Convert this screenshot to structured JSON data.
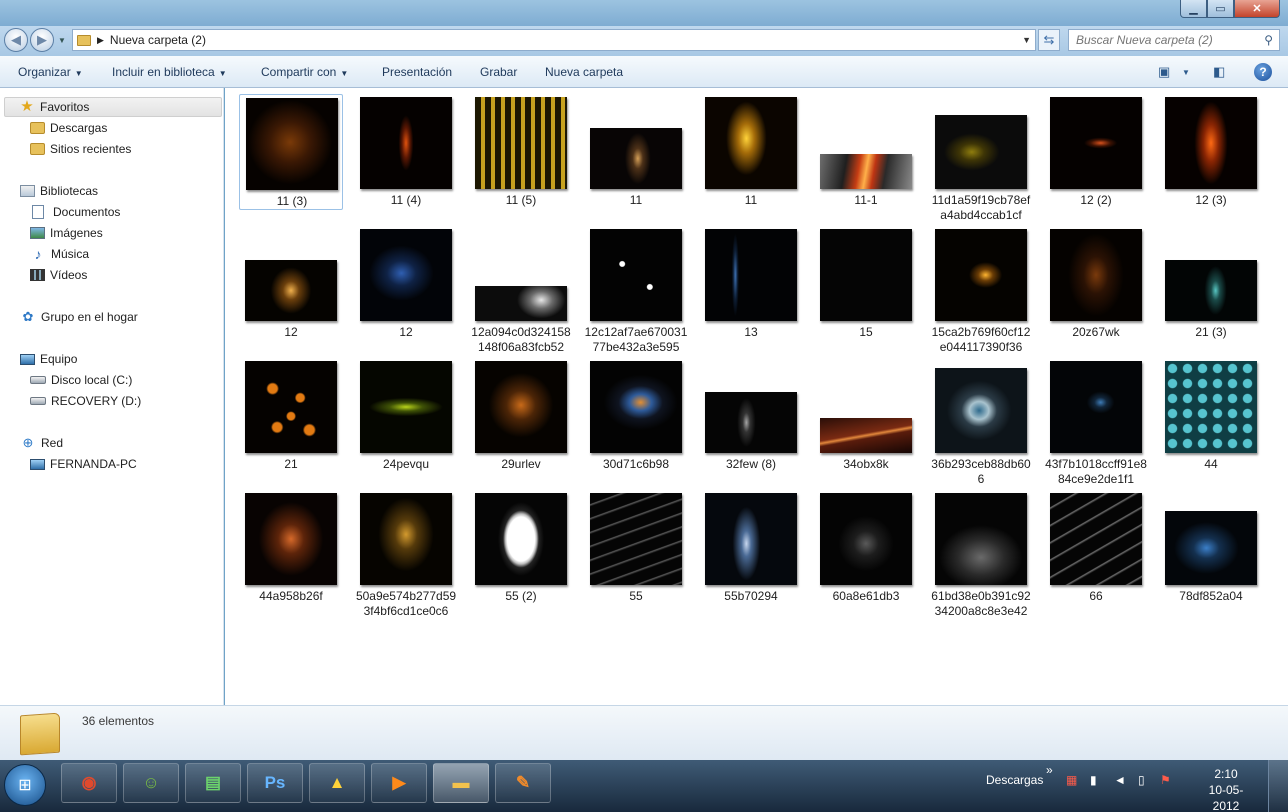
{
  "window": {
    "minimize": "▁",
    "maximize": "▭",
    "close": "✕"
  },
  "address": {
    "path": "Nueva carpeta (2)",
    "search_placeholder": "Buscar Nueva carpeta (2)"
  },
  "toolbar": {
    "organize": "Organizar",
    "include_library": "Incluir en biblioteca",
    "share": "Compartir con",
    "presentation": "Presentación",
    "burn": "Grabar",
    "new_folder": "Nueva carpeta",
    "help": "?"
  },
  "nav": {
    "favorites": "Favoritos",
    "downloads": "Descargas",
    "recent": "Sitios recientes",
    "libraries": "Bibliotecas",
    "documents": "Documentos",
    "images": "Imágenes",
    "music": "Música",
    "videos": "Vídeos",
    "homegroup": "Grupo en el hogar",
    "computer": "Equipo",
    "local_disk": "Disco local (C:)",
    "recovery": "RECOVERY (D:)",
    "network": "Red",
    "network_pc": "FERNANDA-PC"
  },
  "files": [
    {
      "name": "11 (3)",
      "bg": "radial-gradient(ellipse at 48% 48%, #7a3a08 0%, #3a1804 30%, #060200 62%)",
      "h": 1
    },
    {
      "name": "11 (4)",
      "bg": "radial-gradient(ellipse 8% 30% at 50% 50%, #e0520e 0%, #5a1703 55%, #050100 100%)",
      "h": 1
    },
    {
      "name": "11 (5)",
      "bg": "repeating-linear-gradient(90deg, #1d1802 0 6px, #c7a21f 6px 10px)",
      "h": 1
    },
    {
      "name": "11",
      "bg": "radial-gradient(ellipse 14% 42% at 52% 50%, #d49e56 0%, #4d3118 40%, #080505 100%)",
      "h": 0.66
    },
    {
      "name": "11",
      "bg": "radial-gradient(ellipse 22% 40% at 45% 45%, #ffd33a 0%, #a56c09 40%, #0b0500 100%)",
      "h": 1
    },
    {
      "name": "11-1",
      "bg": "linear-gradient(100deg, #6e6e6e 0%, #1f1f1f 28%, #c63d14 42%, #ffb04a 50%, #bf3513 58%, #2a2a2a 70%, #8a8a8a 100%)",
      "h": 0.38
    },
    {
      "name": "11d1a59f19cb78efa4abd4ccab1cf",
      "bg": "radial-gradient(ellipse 30% 25% at 40% 50%, #8f7d0e 0%, #3e3506 45%, #0b0b0b 100%)",
      "h": 0.8
    },
    {
      "name": "12 (2)",
      "bg": "radial-gradient(ellipse 18% 6% at 55% 50%, #d9511c 0%, #3c1203 60%, #050100 100%)",
      "h": 1
    },
    {
      "name": "12 (3)",
      "bg": "radial-gradient(ellipse 18% 45% at 50% 50%, #ff6a14 0%, #8a2503 45%, #060100 100%)",
      "h": 1
    },
    {
      "name": "12",
      "bg": "radial-gradient(ellipse 22% 38% at 50% 50%, #f0b04d 0%, #6b3f0c 40%, #050300 100%)",
      "h": 0.66
    },
    {
      "name": "12",
      "bg": "radial-gradient(ellipse 35% 30% at 45% 48%, #2f5fb2 0%, #0f2245 45%, #020408 100%)",
      "h": 1
    },
    {
      "name": "12a094c0d324158148f06a83fcb52",
      "bg": "radial-gradient(ellipse 35% 70% at 72% 40%, #e8e8e8 0%, #6a6a6a 35%, #0c0c0c 75%)",
      "h": 0.38
    },
    {
      "name": "12c12af7ae67003177be432a3e595",
      "bg": "radial-gradient(circle at 35% 38%, #fff 0 3%, transparent 4%), radial-gradient(circle at 65% 63%, #fff 0 3%, transparent 4%), #030303",
      "h": 1
    },
    {
      "name": "13",
      "bg": "radial-gradient(ellipse 4% 45% at 33% 50%, #3c6fb0 0%, #0d1d33 60%, #020305 100%)",
      "h": 1
    },
    {
      "name": "15",
      "bg": "#050505",
      "h": 1
    },
    {
      "name": "15ca2b769f60cf12e044117390f36",
      "bg": "radial-gradient(ellipse 18% 14% at 55% 50%, #ffb530 0%, #6a3c05 45%, #050300 100%)",
      "h": 1
    },
    {
      "name": "20z67wk",
      "bg": "radial-gradient(ellipse 30% 45% at 50% 50%, #7a3a0c 0%, #2b1204 45%, #050200 100%)",
      "h": 1
    },
    {
      "name": "21 (3)",
      "bg": "radial-gradient(ellipse 12% 40% at 55% 50%, #58c6c2 0%, #1a4a48 40%, #020505 100%)",
      "h": 0.66
    },
    {
      "name": "21",
      "bg": "radial-gradient(circle at 30% 30%, #e27a12 0 5%, transparent 7%), radial-gradient(circle at 60% 40%, #e27a12 0 5%, transparent 7%), radial-gradient(circle at 50% 60%, #e27a12 0 5%, transparent 7%), radial-gradient(circle at 35% 72%, #e27a12 0 5%, transparent 7%), radial-gradient(circle at 70% 75%, #e27a12 0 5%, transparent 7%), #050200",
      "h": 1
    },
    {
      "name": "24pevqu",
      "bg": "radial-gradient(ellipse 40% 10% at 50% 50%, #b9d41a 0%, #3f5206 45%, #050600 100%)",
      "h": 1
    },
    {
      "name": "29urlev",
      "bg": "radial-gradient(ellipse 35% 35% at 50% 48%, #c86a19 0%, #4c2507 45%, #060300 100%)",
      "h": 1
    },
    {
      "name": "30d71c6b98",
      "bg": "radial-gradient(ellipse 40% 30% at 55% 45%, #e28e33 0%, #2e5b9b 30%, #0f1420 60%, #030303 100%)",
      "h": 1
    },
    {
      "name": "32few (8)",
      "bg": "radial-gradient(ellipse 10% 40% at 45% 50%, #a5a5a5 0%, #333 40%, #050505 100%)",
      "h": 0.66
    },
    {
      "name": "34obx8k",
      "bg": "linear-gradient(170deg, #2a0e08 0%, #7a2a12 45%, #e2883c 50%, #5a1c0c 56%, #150604 100%)",
      "h": 0.38
    },
    {
      "name": "36b293ceb88db606",
      "bg": "radial-gradient(ellipse 35% 35% at 48% 50%, #2e6a8c 0%, #a9c3ce 30%, #2b3b46 55%, #0d1419 100%)",
      "h": 0.92
    },
    {
      "name": "43f7b1018ccff91e884ce9e2de1f1",
      "bg": "radial-gradient(ellipse 15% 12% at 55% 45%, #3d7bb6 0%, #112539 45%, #030507 100%)",
      "h": 1
    },
    {
      "name": "44",
      "bg": "radial-gradient(circle at 50% 50%, #56c4cf 0 40%, #0f3e44 48%) 0 0 / 15px 15px, #0b2c30",
      "h": 1
    },
    {
      "name": "44a958b26f",
      "bg": "radial-gradient(ellipse 35% 40% at 50% 50%, #d6692a 0%, #5d240a 40%, #080302 100%)",
      "h": 1
    },
    {
      "name": "50a9e574b277d593f4bf6cd1ce0c6",
      "bg": "radial-gradient(ellipse 30% 40% at 50% 45%, #d39a2e 0%, #553a0b 40%, #060400 100%)",
      "h": 1
    },
    {
      "name": "55 (2)",
      "bg": "radial-gradient(ellipse 25% 40% at 50% 50%, transparent 60%, #bdbdbd 68%, #222 78%, #050505 100%)",
      "h": 1
    },
    {
      "name": "55",
      "bg": "repeating-linear-gradient(160deg, #050505 0 10px, #5a5a5a 11px, #050505 13px)",
      "h": 1
    },
    {
      "name": "55b70294",
      "bg": "radial-gradient(ellipse 15% 40% at 45% 55%, #c7d7ef 0%, #4a6a95 35%, #05080d 100%)",
      "h": 1
    },
    {
      "name": "60a8e61db3",
      "bg": "radial-gradient(ellipse 30% 30% at 50% 55%, #5a5a5a 0%, #1d1d1d 45%, #040404 100%)",
      "h": 1
    },
    {
      "name": "61bd38e0b391c9234200a8c8e3e42",
      "bg": "radial-gradient(ellipse 45% 35% at 50% 70%, #6a6a6a 0%, #2a2a2a 55%, #050505 100%)",
      "h": 1
    },
    {
      "name": "66",
      "bg": "repeating-linear-gradient(150deg, #050505 0 12px, #6f6f6f 13px, #050505 15px)",
      "h": 1
    },
    {
      "name": "78df852a04",
      "bg": "radial-gradient(ellipse 35% 35% at 45% 50%, #3b7fc9 0%, #14304f 40%, #03060a 100%)",
      "h": 0.8
    }
  ],
  "details": {
    "count": "36 elementos"
  },
  "taskbar": {
    "downloads": "Descargas",
    "chevron": "»",
    "time": "2:10",
    "date": "10-05-2012",
    "photoshop": "Ps"
  }
}
